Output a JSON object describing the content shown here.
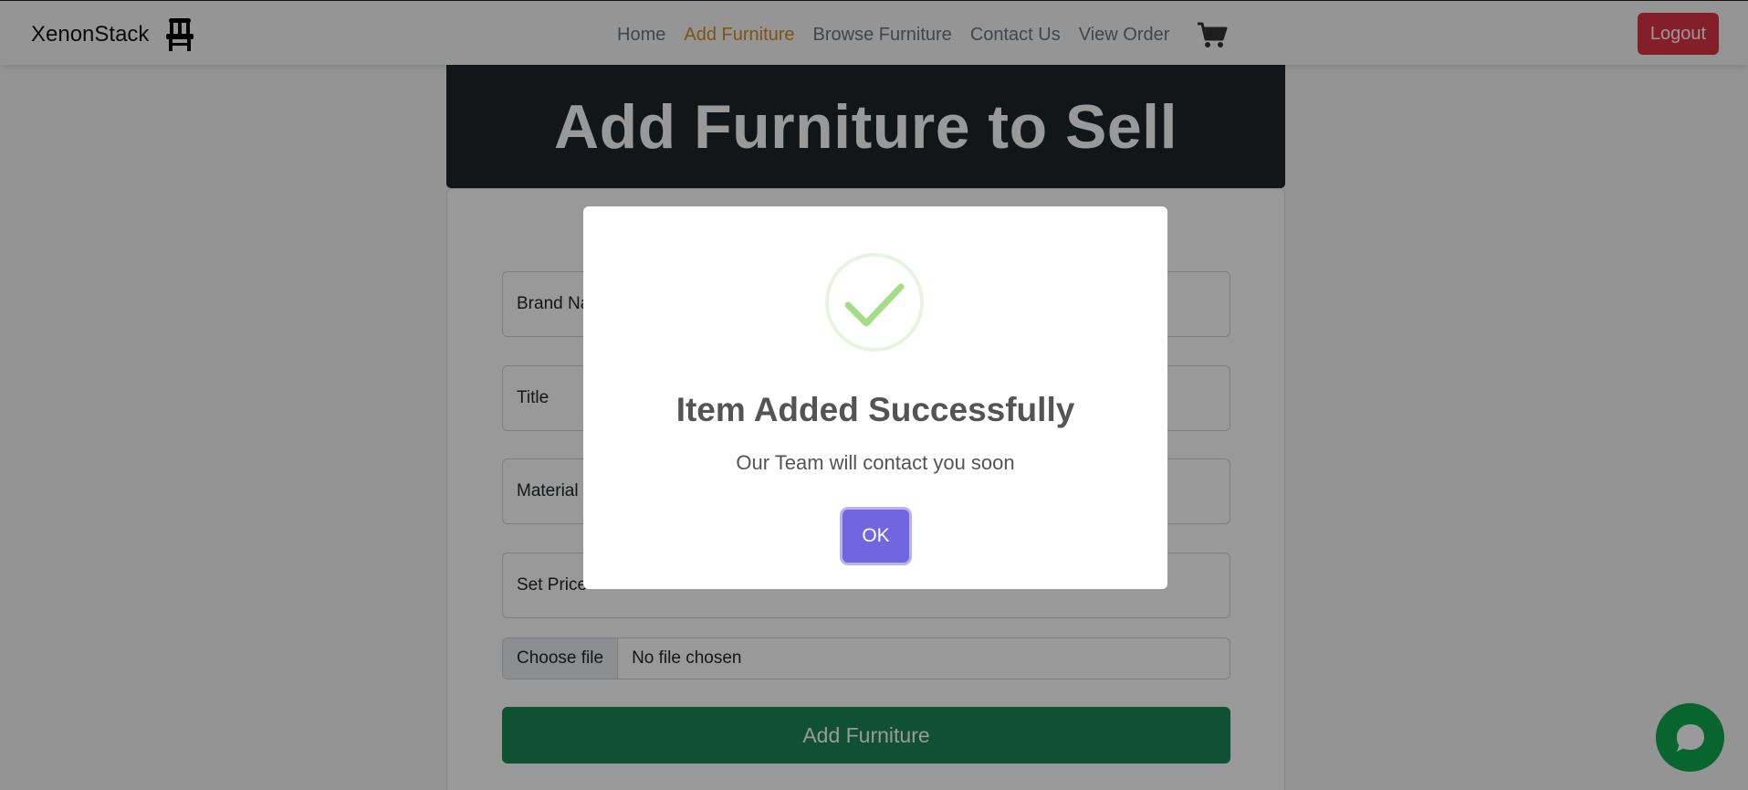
{
  "navbar": {
    "brand": "XenonStack",
    "links": [
      {
        "label": "Home"
      },
      {
        "label": "Add Furniture"
      },
      {
        "label": "Browse Furniture"
      },
      {
        "label": "Contact Us"
      },
      {
        "label": "View Order"
      }
    ],
    "active_link": "Add Furniture",
    "logout_label": "Logout"
  },
  "banner": {
    "title": "Add Furniture to Sell"
  },
  "form": {
    "fields": {
      "brand": "Brand Name",
      "title": "Title",
      "material": "Material",
      "price": "Set Price"
    },
    "file": {
      "button": "Choose file",
      "status": "No file chosen"
    },
    "submit_label": "Add Furniture"
  },
  "modal": {
    "title": "Item Added Successfully",
    "text": "Our Team will contact you soon",
    "ok_label": "OK"
  },
  "colors": {
    "accent_link": "#d08a2a",
    "logout": "#dc3545",
    "submit": "#198754",
    "ok_button": "#7066e0",
    "success_check": "#a5dc86",
    "chat": "#0fa84e"
  },
  "icons": [
    "chair-icon",
    "cart-icon",
    "chat-icon",
    "success-check-icon"
  ]
}
